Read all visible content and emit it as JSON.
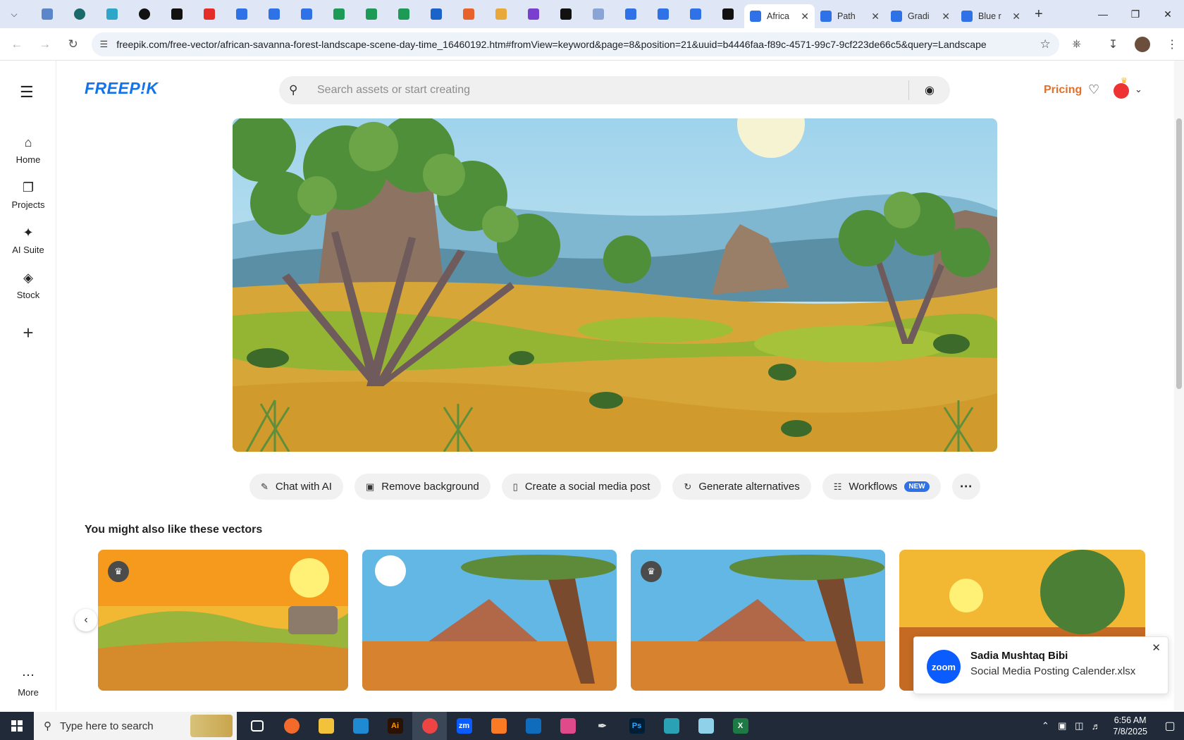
{
  "browser": {
    "tabs": [
      {
        "title": "Africa",
        "active": true
      },
      {
        "title": "Path",
        "active": false
      },
      {
        "title": "Gradi",
        "active": false
      },
      {
        "title": "Blue r",
        "active": false
      }
    ],
    "url": "freepik.com/free-vector/african-savanna-forest-landscape-scene-day-time_16460192.htm#fromView=keyword&page=8&position=21&uuid=b4446faa-f89c-4571-99c7-9cf223de66c5&query=Landscape"
  },
  "site": {
    "logo": "FREEP!K",
    "search_placeholder": "Search assets or start creating",
    "pricing": "Pricing"
  },
  "sidebar": {
    "items": [
      {
        "label": "Home",
        "icon": "home-icon"
      },
      {
        "label": "Projects",
        "icon": "projects-icon"
      },
      {
        "label": "AI Suite",
        "icon": "sparkle-icon"
      },
      {
        "label": "Stock",
        "icon": "stock-icon"
      }
    ],
    "more": "More"
  },
  "actions": {
    "chat": "Chat with AI",
    "remove_bg": "Remove background",
    "social": "Create a social media post",
    "alternatives": "Generate alternatives",
    "workflows": "Workflows",
    "new_badge": "NEW"
  },
  "related": {
    "title": "You might also like these vectors"
  },
  "toast": {
    "logo": "zoom",
    "name": "Sadia Mushtaq Bibi",
    "file": "Social Media Posting Calender.xlsx"
  },
  "taskbar": {
    "search_placeholder": "Type here to search",
    "time": "6:56 AM",
    "date": "7/8/2025"
  },
  "colors": {
    "brand": "#1273eb",
    "pricing": "#e2702b",
    "new_badge": "#2f72e8",
    "zoom": "#0b5cff"
  }
}
